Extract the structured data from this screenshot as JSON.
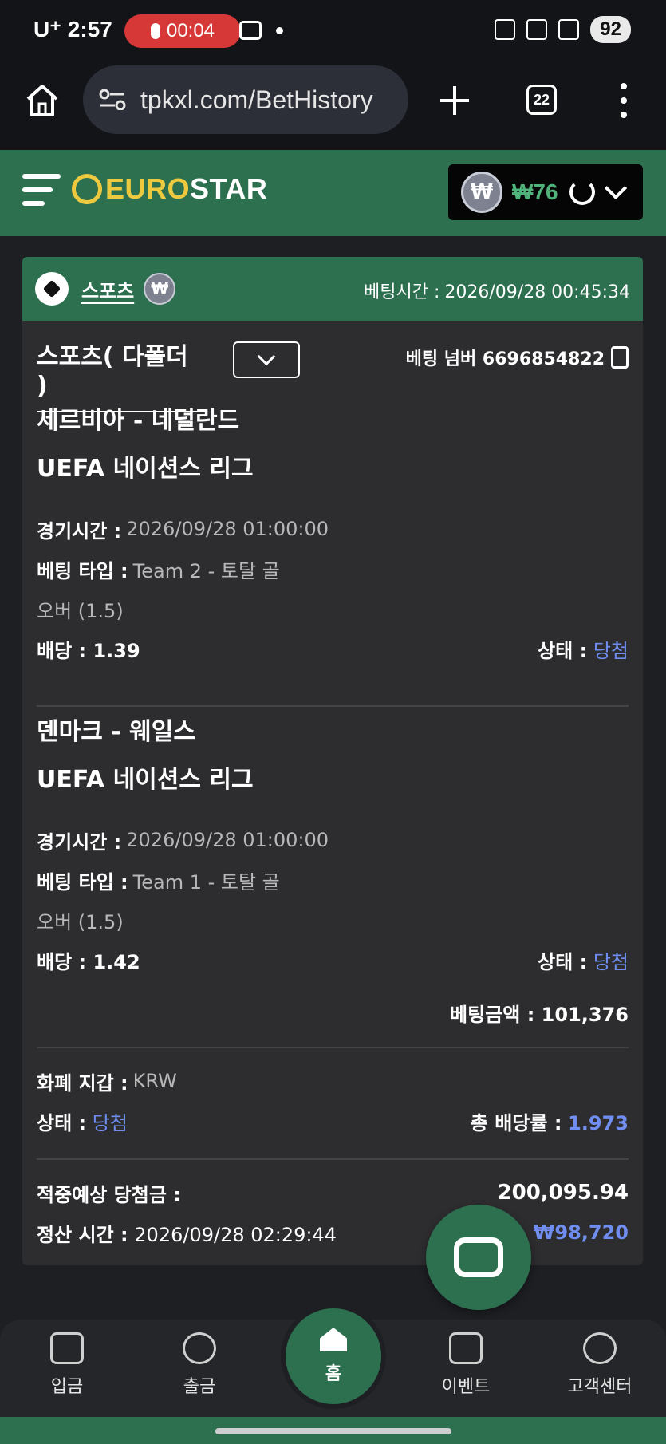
{
  "status_bar": {
    "carrier_time": "U⁺ 2:57",
    "recording": "00:04",
    "battery": "92"
  },
  "browser": {
    "url": "tpkxl.com/BetHistory",
    "tab_count": "22"
  },
  "header": {
    "logo_part1": "EURO",
    "logo_part2": "STAR",
    "won_symbol": "₩",
    "balance": "₩76"
  },
  "card": {
    "category": "스포츠",
    "bet_time_label": "베팅시간 :",
    "bet_time_value": "2026/09/28 00:45:34",
    "selector_title": "스포츠( 다폴더 )",
    "bet_number": "베팅 넘버 6696854822",
    "matches": [
      {
        "teams": "세르비아 - 네덜란드",
        "league": "UEFA 네이션스 리그",
        "time_label": "경기시간 :",
        "time_value": "2026/09/28 01:00:00",
        "type_label": "베팅 타입 :",
        "type_value": "Team 2 - 토탈 골",
        "type_value2": "오버 (1.5)",
        "odds": "배당 : 1.39",
        "status_label": "상태 :",
        "status_value": "당첨"
      },
      {
        "teams": "덴마크 - 웨일스",
        "league": "UEFA 네이션스 리그",
        "time_label": "경기시간 :",
        "time_value": "2026/09/28 01:00:00",
        "type_label": "베팅 타입 :",
        "type_value": "Team 1 - 토탈 골",
        "type_value2": "오버 (1.5)",
        "odds": "배당 : 1.42",
        "status_label": "상태 :",
        "status_value": "당첨"
      }
    ],
    "bet_amount": "베팅금액 : 101,376",
    "wallet_label": "화폐 지갑 :",
    "wallet_value": "KRW",
    "overall_status_label": "상태 :",
    "overall_status_value": "당첨",
    "total_odds_label": "총 배당률 :",
    "total_odds_value": "1.973",
    "expected_win_label": "적중예상 당첨금 :",
    "expected_win_value": "200,095.94",
    "settle_label": "정산 시간 :",
    "settle_value": "2026/09/28 02:29:44",
    "settle_amount": "₩98,720"
  },
  "bottom_nav": {
    "deposit": "입금",
    "withdraw": "출금",
    "home": "홈",
    "event": "이벤트",
    "support": "고객센터"
  },
  "colors": {
    "brand_green": "#2d7050",
    "accent_yellow": "#ecc93f",
    "status_blue": "#6f8ef0",
    "balance_green": "#4fb37a"
  }
}
